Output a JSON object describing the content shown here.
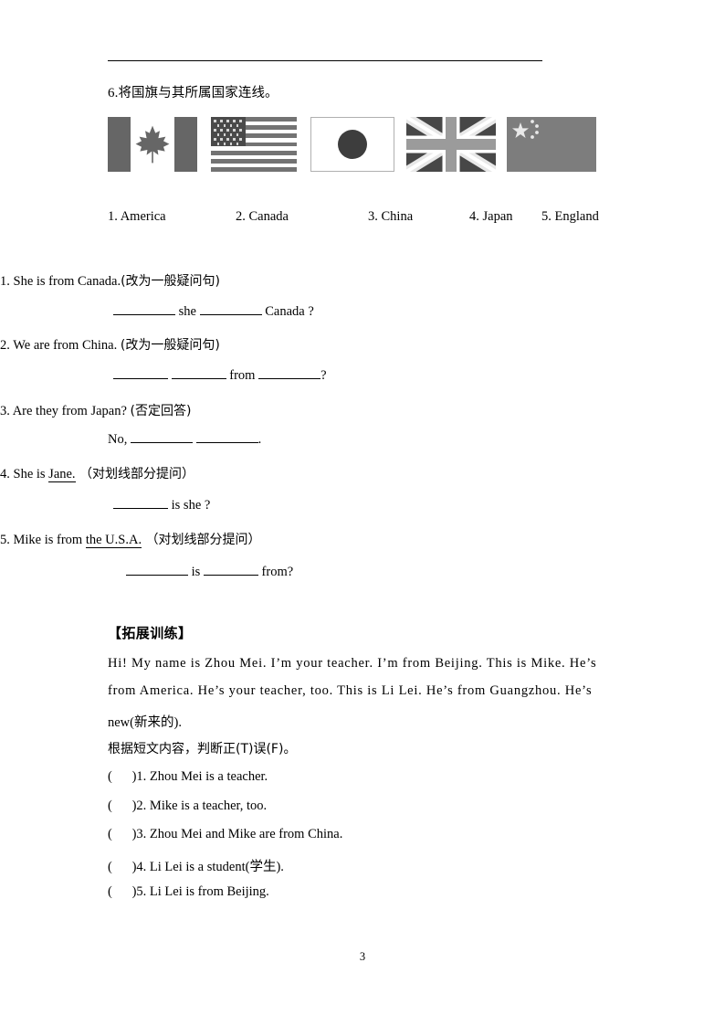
{
  "document": {
    "page_number": "3"
  },
  "match_exercise": {
    "number": "6.",
    "instruction": "将国旗与其所属国家连线。",
    "flags": [
      {
        "name": "canada-flag",
        "country": "Canada"
      },
      {
        "name": "usa-flag",
        "country": "America"
      },
      {
        "name": "japan-flag",
        "country": "Japan"
      },
      {
        "name": "uk-flag",
        "country": "England"
      },
      {
        "name": "china-flag",
        "country": "China"
      }
    ],
    "countries": [
      {
        "label": "1. America"
      },
      {
        "label": "2. Canada"
      },
      {
        "label": "3. China"
      },
      {
        "label": "4. Japan"
      },
      {
        "label": "5. England"
      }
    ]
  },
  "transform_questions": [
    {
      "stem_num": "1.",
      "stem_text": " She is from Canada.",
      "stem_hint": "(改为一般疑问句)",
      "answer_parts": [
        "",
        " she ",
        " Canada ?"
      ]
    },
    {
      "stem_num": "2.",
      "stem_text": " We are from China. ",
      "stem_hint": "(改为一般疑问句)",
      "answer_parts": [
        "",
        " ",
        " from ",
        "?"
      ]
    },
    {
      "stem_num": "3.",
      "stem_text": " Are they from Japan? ",
      "stem_hint": "(否定回答)",
      "answer_parts": [
        "No, ",
        " ",
        "."
      ]
    },
    {
      "stem_num": "4.",
      "stem_text": " She is ",
      "stem_underlined": "Jane.",
      "stem_hint": " （对划线部分提问）",
      "answer_parts": [
        "",
        " is she ?"
      ]
    },
    {
      "stem_num": "5.",
      "stem_text": " Mike is from ",
      "stem_underlined": "the U.S.A.",
      "stem_hint": " （对划线部分提问）",
      "answer_parts": [
        "",
        " is ",
        " from?"
      ]
    }
  ],
  "extension": {
    "heading": "【拓展训练】",
    "passage_lines": [
      "Hi! My name is Zhou Mei. I’m your teacher. I’m from Beijing. This is Mike. He’s",
      "from America. He’s your teacher, too. This is Li Lei. He’s from Guangzhou. He’s",
      "new(新来的)."
    ],
    "tf_instruction": "根据短文内容，判断正(T)误(F)。",
    "tf_items": [
      {
        "paren": "(      )",
        "text": "1. Zhou Mei is a teacher."
      },
      {
        "paren": "(      )",
        "text": "2. Mike is a teacher, too."
      },
      {
        "paren": "(      )",
        "text": "3. Zhou Mei and Mike are from China."
      },
      {
        "paren": "(      )",
        "text": "4. Li Lei is a student(学生)."
      },
      {
        "paren": "(      )",
        "text": "5. Li Lei is from Beijing."
      }
    ]
  },
  "colors": {
    "flag_gray": "#666666",
    "flag_dark": "#4a4a4a",
    "flag_mid": "#737373",
    "china_bg": "#7d7d7d",
    "uk_bg": "#474747"
  }
}
